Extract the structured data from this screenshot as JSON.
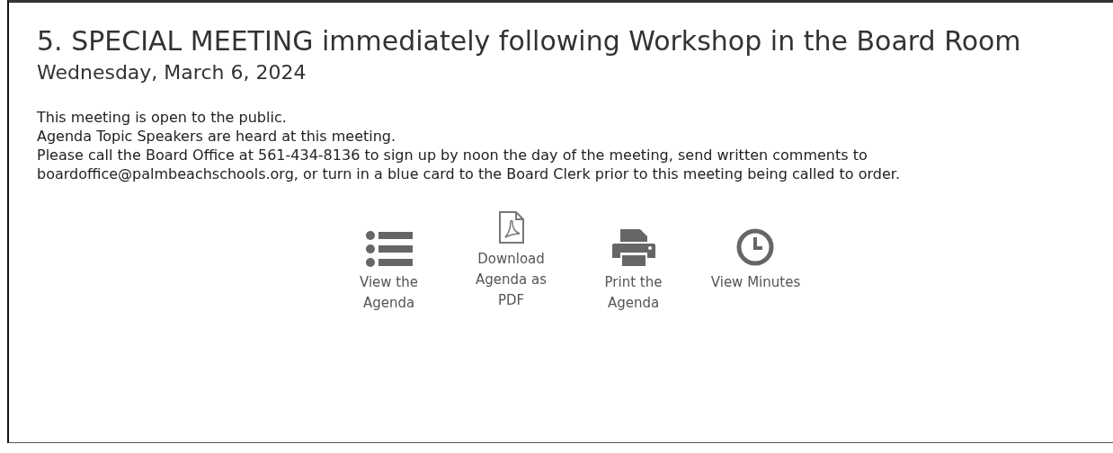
{
  "meeting": {
    "title": "5. SPECIAL MEETING immediately following Workshop in the Board Room",
    "date": "Wednesday, March 6, 2024"
  },
  "notes": [
    "This meeting is open to the public.",
    "Agenda Topic Speakers are heard at this meeting.",
    "Please call the Board Office at 561-434-8136 to sign up by noon the day of the meeting, send written comments to boardoffice@palmbeachschools.org, or turn in a blue card to the Board Clerk prior to this meeting being called to order."
  ],
  "actions": [
    {
      "kind": "list",
      "label": "View the Agenda"
    },
    {
      "kind": "pdf",
      "label": "Download Agenda as PDF"
    },
    {
      "kind": "print",
      "label": "Print the Agenda"
    },
    {
      "kind": "clock",
      "label": "View Minutes"
    }
  ]
}
